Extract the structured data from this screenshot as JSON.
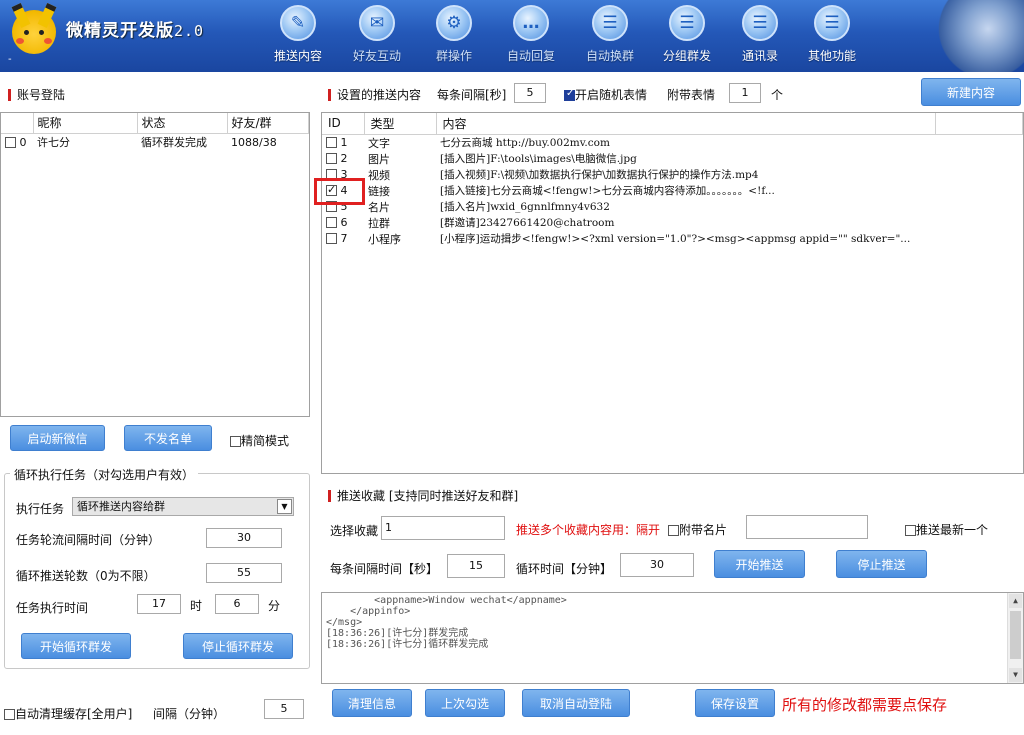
{
  "app": {
    "title_cn": "微精灵开发版",
    "title_ver": "2.0",
    "dash": "-"
  },
  "nav": [
    {
      "label": "推送内容",
      "icon": "pen-icon",
      "glyph": "✎"
    },
    {
      "label": "好友互动",
      "icon": "user-chat-icon",
      "glyph": "✉"
    },
    {
      "label": "群操作",
      "icon": "gear-icon",
      "glyph": "⚙"
    },
    {
      "label": "自动回复",
      "icon": "chat-bubble-icon",
      "glyph": "…"
    },
    {
      "label": "自动换群",
      "icon": "chat-bubble-icon",
      "glyph": "☰"
    },
    {
      "label": "分组群发",
      "icon": "chat-bubble-icon",
      "glyph": "☰"
    },
    {
      "label": "通讯录",
      "icon": "chat-bubble-icon",
      "glyph": "☰"
    },
    {
      "label": "其他功能",
      "icon": "chat-bubble-icon",
      "glyph": "☰"
    }
  ],
  "account": {
    "section_title": "账号登陆",
    "columns": [
      "昵称",
      "状态",
      "好友/群"
    ],
    "rows": [
      {
        "id": "0",
        "nickname": "许七分",
        "status": "循环群发完成",
        "friends": "1088/38"
      }
    ],
    "btn_launch": "启动新微信",
    "btn_blacklist": "不发名单",
    "simple_mode": "精简模式"
  },
  "loop": {
    "group_title": "循环执行任务（对勾选用户有效）",
    "task_label": "执行任务",
    "task_value": "循环推送内容给群",
    "interval_label": "任务轮流间隔时间（分钟）",
    "interval_value": "30",
    "rounds_label": "循环推送轮数（0为不限）",
    "rounds_value": "55",
    "time_label": "任务执行时间",
    "hour_value": "17",
    "hour_unit": "时",
    "minute_value": "6",
    "minute_unit": "分",
    "btn_start": "开始循环群发",
    "btn_stop": "停止循环群发"
  },
  "autoclean": {
    "label": "自动清理缓存[全用户]",
    "interval_label": "间隔（分钟）",
    "interval_value": "5"
  },
  "push": {
    "section_title": "设置的推送内容",
    "interval_label": "每条间隔[秒]",
    "interval_value": "5",
    "random_emoji": "开启随机表情",
    "attach_emoji_label": "附带表情",
    "attach_emoji_value": "1",
    "attach_emoji_unit": "个",
    "btn_new": "新建内容",
    "columns": [
      "ID",
      "类型",
      "内容"
    ],
    "rows": [
      {
        "id": "1",
        "type": "文字",
        "content": "七分云商城  http://buy.002mv.com",
        "checked": false
      },
      {
        "id": "2",
        "type": "图片",
        "content": "[插入图片]F:\\tools\\images\\电脑微信.jpg",
        "checked": false
      },
      {
        "id": "3",
        "type": "视频",
        "content": "[插入视频]F:\\视频\\加数据执行保护\\加数据执行保护的操作方法.mp4",
        "checked": false
      },
      {
        "id": "4",
        "type": "链接",
        "content": "[插入链接]七分云商城<!fengw!>七分云商城内容待添加。。。。。。。<!f...",
        "checked": true
      },
      {
        "id": "5",
        "type": "名片",
        "content": "[插入名片]wxid_6gnnlfmny4v632",
        "checked": false
      },
      {
        "id": "6",
        "type": "拉群",
        "content": "[群邀请]23427661420@chatroom",
        "checked": false
      },
      {
        "id": "7",
        "type": "小程序",
        "content": "[小程序]运动揖步<!fengw!><?xml version=\"1.0\"?><msg><appmsg appid=\"\" sdkver=\"...",
        "checked": false
      }
    ]
  },
  "fav": {
    "section_title": "推送收藏 [支持同时推送好友和群]",
    "select_label": "选择收藏",
    "select_value": "1",
    "multi_hint": "推送多个收藏内容用：隔开",
    "attach_card": "附带名片",
    "attach_card_value": "",
    "push_latest": "推送最新一个",
    "interval_label": "每条间隔时间【秒】",
    "interval_value": "15",
    "loop_label": "循环时间【分钟】",
    "loop_value": "30",
    "btn_start": "开始推送",
    "btn_stop": "停止推送"
  },
  "log": {
    "lines": [
      "        <appname>Window wechat</appname>",
      "    </appinfo>",
      "</msg>",
      "",
      "[18:36:26][许七分]群发完成",
      "[18:36:26][许七分]循环群发完成"
    ]
  },
  "bottom": {
    "btn_clear": "清理信息",
    "btn_last": "上次勾选",
    "btn_cancel_auto": "取消自动登陆",
    "btn_save": "保存设置",
    "save_hint": "所有的修改都需要点保存"
  }
}
